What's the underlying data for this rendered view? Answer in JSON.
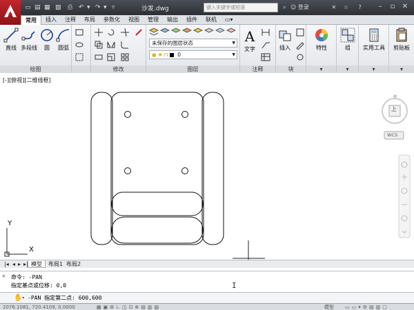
{
  "titlebar": {
    "doc_title": "沙发.dwg",
    "search_placeholder": "键入关键字或短语",
    "login": "登录",
    "help": "?"
  },
  "tabs": [
    "常用",
    "插入",
    "注释",
    "布局",
    "参数化",
    "视图",
    "管理",
    "输出",
    "插件",
    "联机"
  ],
  "ribbon": {
    "draw": {
      "title": "绘图",
      "tools": [
        "直线",
        "多段线",
        "圆",
        "圆弧"
      ]
    },
    "modify": {
      "title": "修改"
    },
    "layers": {
      "title": "图层",
      "state": "未保存的图层状态",
      "current": "0"
    },
    "annotation": {
      "title": "注释",
      "text": "文字"
    },
    "block": {
      "title": "块",
      "insert": "插入"
    },
    "properties": {
      "label": "特性"
    },
    "groups": {
      "label": "组"
    },
    "utilities": {
      "label": "实用工具"
    },
    "clipboard": {
      "label": "剪贴板"
    }
  },
  "canvas": {
    "view_label": "[-][俯视][二维线框]",
    "axis_x": "X",
    "axis_y": "Y",
    "viewcube_top": "上",
    "wcs": "WCS"
  },
  "layout_tabs": [
    "模型",
    "布局1",
    "布局2"
  ],
  "command": {
    "history": [
      "命令: -PAN",
      "指定基点或位移: 0,0"
    ],
    "current": "-PAN 指定第二点: 600,600"
  },
  "status": {
    "coords": "2076.1081, 720.4109, 0.0000",
    "model": "模型"
  },
  "colors": {
    "accent": "#c0272d",
    "ribbon_bg": "#eceff2"
  }
}
